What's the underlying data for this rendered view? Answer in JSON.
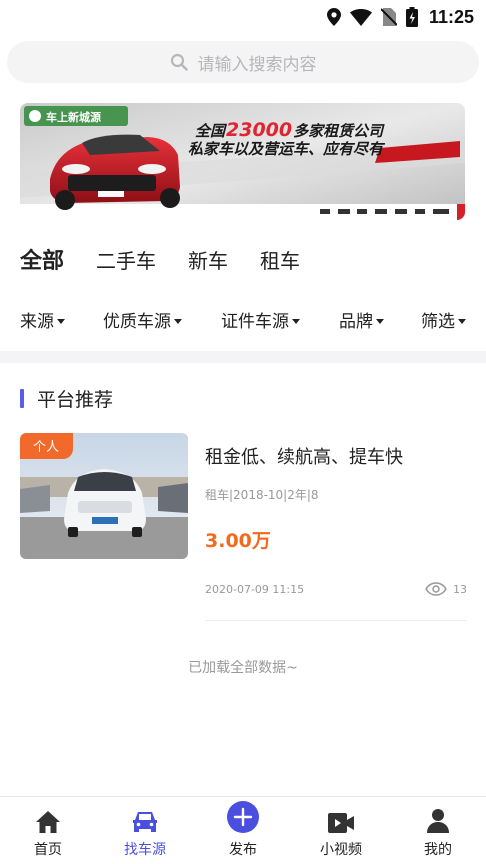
{
  "status_bar": {
    "time": "11:25"
  },
  "search": {
    "placeholder": "请输入搜索内容"
  },
  "banner": {
    "brand": "车上新城源",
    "headline_prefix": "全国",
    "headline_number": "23000",
    "headline_suffix": "多家租赁公司",
    "subline": "私家车以及营运车、应有尽有"
  },
  "category_tabs": [
    {
      "label": "全部",
      "active": true
    },
    {
      "label": "二手车",
      "active": false
    },
    {
      "label": "新车",
      "active": false
    },
    {
      "label": "租车",
      "active": false
    }
  ],
  "filters": [
    {
      "label": "来源"
    },
    {
      "label": "优质车源"
    },
    {
      "label": "证件车源"
    },
    {
      "label": "品牌"
    },
    {
      "label": "筛选"
    }
  ],
  "section": {
    "title": "平台推荐"
  },
  "listings": [
    {
      "tag": "个人",
      "title": "租金低、续航高、提车快",
      "meta": "租车|2018-10|2年|8",
      "price": "3.00万",
      "date": "2020-07-09 11:15",
      "views": "13"
    }
  ],
  "list_footer": "已加载全部数据~",
  "bottom_nav": [
    {
      "label": "首页",
      "icon": "home-icon",
      "active": false
    },
    {
      "label": "找车源",
      "icon": "car-icon",
      "active": true
    },
    {
      "label": "发布",
      "icon": "plus-circle-icon",
      "active": false
    },
    {
      "label": "小视频",
      "icon": "video-camera-icon",
      "active": false
    },
    {
      "label": "我的",
      "icon": "user-icon",
      "active": false
    }
  ],
  "colors": {
    "accent": "#4a4fe0",
    "price": "#f26a1b",
    "tag": "#f26a2b",
    "section_bar": "#5a5de8"
  }
}
